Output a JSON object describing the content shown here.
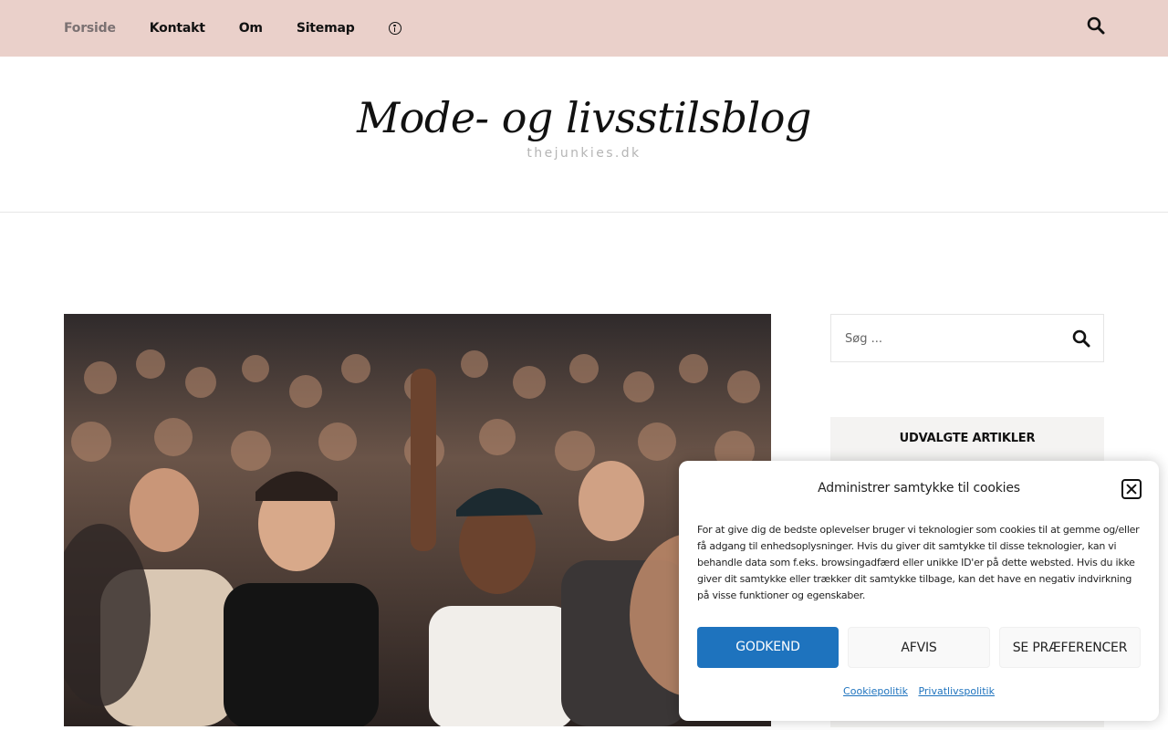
{
  "nav": {
    "items": [
      {
        "label": "Forside",
        "active": true
      },
      {
        "label": "Kontakt"
      },
      {
        "label": "Om"
      },
      {
        "label": "Sitemap"
      }
    ],
    "accessibility_icon": "accessibility-icon",
    "search_icon": "search-icon",
    "background": "#ead0ca"
  },
  "header": {
    "title": "Mode- og livsstilsblog",
    "subtitle": "thejunkies.dk"
  },
  "hero": {
    "image": "concert-crowd-photo"
  },
  "sidebar": {
    "search_placeholder": "Søg ...",
    "widget_title": "UDVALGTE ARTIKLER"
  },
  "cookie": {
    "title": "Administrer samtykke til cookies",
    "body": "For at give dig de bedste oplevelser bruger vi teknologier som cookies til at gemme og/eller få adgang til enhedsoplysninger. Hvis du giver dit samtykke til disse teknologier, kan vi behandle data som f.eks. browsingadfærd eller unikke ID'er på dette websted. Hvis du ikke giver dit samtykke eller trækker dit samtykke tilbage, kan det have en negativ indvirkning på visse funktioner og egenskaber.",
    "accept_label": "GODKEND",
    "deny_label": "AFVIS",
    "prefs_label": "SE PRÆFERENCER",
    "link_cookie": "Cookiepolitik",
    "link_privacy": "Privatlivspolitik",
    "accent": "#1e73be"
  }
}
